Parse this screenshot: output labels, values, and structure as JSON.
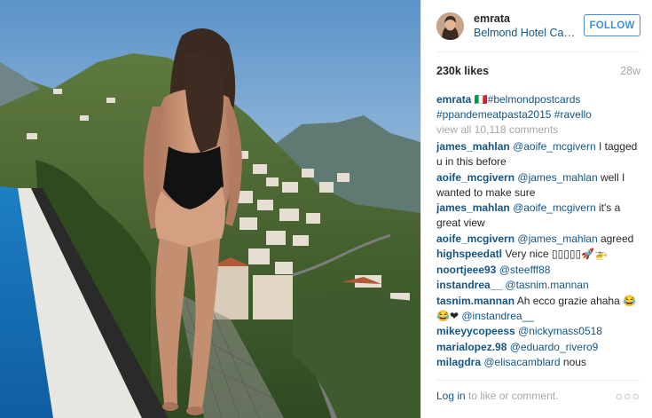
{
  "header": {
    "username": "emrata",
    "location": "Belmond Hotel Caruso, Ravello",
    "follow_label": "FOLLOW"
  },
  "stats": {
    "likes": "230k likes",
    "age": "28w"
  },
  "caption": {
    "user": "emrata",
    "flag_text": "🇮🇹",
    "tags": [
      "#belmondpostcards",
      "#ppandemeatpasta2015",
      "#ravello"
    ]
  },
  "view_all": "view all 10,118 comments",
  "comments": [
    {
      "user": "james_mahlan",
      "mention": "@aoife_mcgivern",
      "text": " I tagged u in this before"
    },
    {
      "user": "aoife_mcgivern",
      "mention": "@james_mahlan",
      "text": " well I wanted to make sure"
    },
    {
      "user": "james_mahlan",
      "mention": "@aoife_mcgivern",
      "text": " it's a great view"
    },
    {
      "user": "aoife_mcgivern",
      "mention": "@james_mahlan",
      "text": " agreed"
    },
    {
      "user": "highspeedatl",
      "mention": "",
      "text": " Very nice ▯▯▯▯▯🚀🚁"
    },
    {
      "user": "noortjeee93",
      "mention": "@steefff88",
      "text": ""
    },
    {
      "user": "instandrea__",
      "mention": "@tasnim.mannan",
      "text": ""
    },
    {
      "user": "tasnim.mannan",
      "mention": "",
      "text": " Ah ecco grazie ahaha 😂😂❤ ",
      "mention2": "@instandrea__"
    },
    {
      "user": "mikeyycopeess",
      "mention": "@nickymass0518",
      "text": ""
    },
    {
      "user": "marialopez.98",
      "mention": "@eduardo_rivero9",
      "text": ""
    },
    {
      "user": "milagdra",
      "mention": "@elisacamblard",
      "text": " nous"
    }
  ],
  "footer": {
    "login_link": "Log in",
    "login_rest": " to like or comment.",
    "more_icon": "ellipsis-icon",
    "more_glyph": "○○○"
  },
  "colors": {
    "link_blue": "#125688",
    "follow_blue": "#4090db",
    "muted_gray": "#a5a7aa",
    "text_dark": "#262626"
  }
}
